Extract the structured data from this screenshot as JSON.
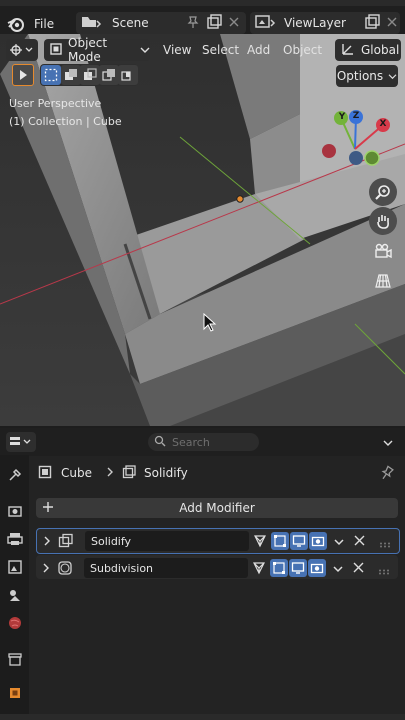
{
  "topbar": {
    "file_label": "File",
    "scene_label": "Scene",
    "viewlayer_label": "ViewLayer"
  },
  "viewport_header": {
    "mode_label": "Object Mode",
    "menus": [
      "View",
      "Select",
      "Add",
      "Object"
    ],
    "orientation_label": "Global",
    "options_label": "Options"
  },
  "overlay": {
    "view_name": "User Perspective",
    "collection_info": "(1) Collection | Cube"
  },
  "gizmo": {
    "x_label": "X",
    "y_label": "Y",
    "z_label": "Z"
  },
  "properties": {
    "search_placeholder": "Search",
    "breadcrumb_object": "Cube",
    "breadcrumb_modifier": "Solidify",
    "add_modifier_label": "Add Modifier",
    "modifiers": [
      {
        "name": "Solidify",
        "active": true
      },
      {
        "name": "Subdivision",
        "active": false
      }
    ]
  },
  "colors": {
    "accent_blue": "#4772b3",
    "object_orange": "#e68a2e",
    "axis_red": "#d83a4a",
    "axis_green": "#73b33a",
    "axis_blue": "#3a73d8"
  }
}
